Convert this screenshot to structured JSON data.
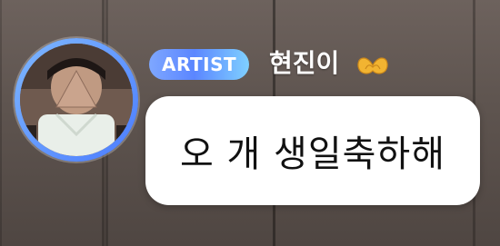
{
  "chat": {
    "role_badge": "ARTIST",
    "sender_name": "현진이",
    "sender_emoji_icon": "heart-hands-icon",
    "message_text": "오 개 생일축하해"
  },
  "colors": {
    "badge_gradient_start": "#7ea7ff",
    "badge_gradient_end": "#7fd0ff",
    "avatar_ring": "#5b86ff",
    "bubble_bg": "#ffffff"
  }
}
